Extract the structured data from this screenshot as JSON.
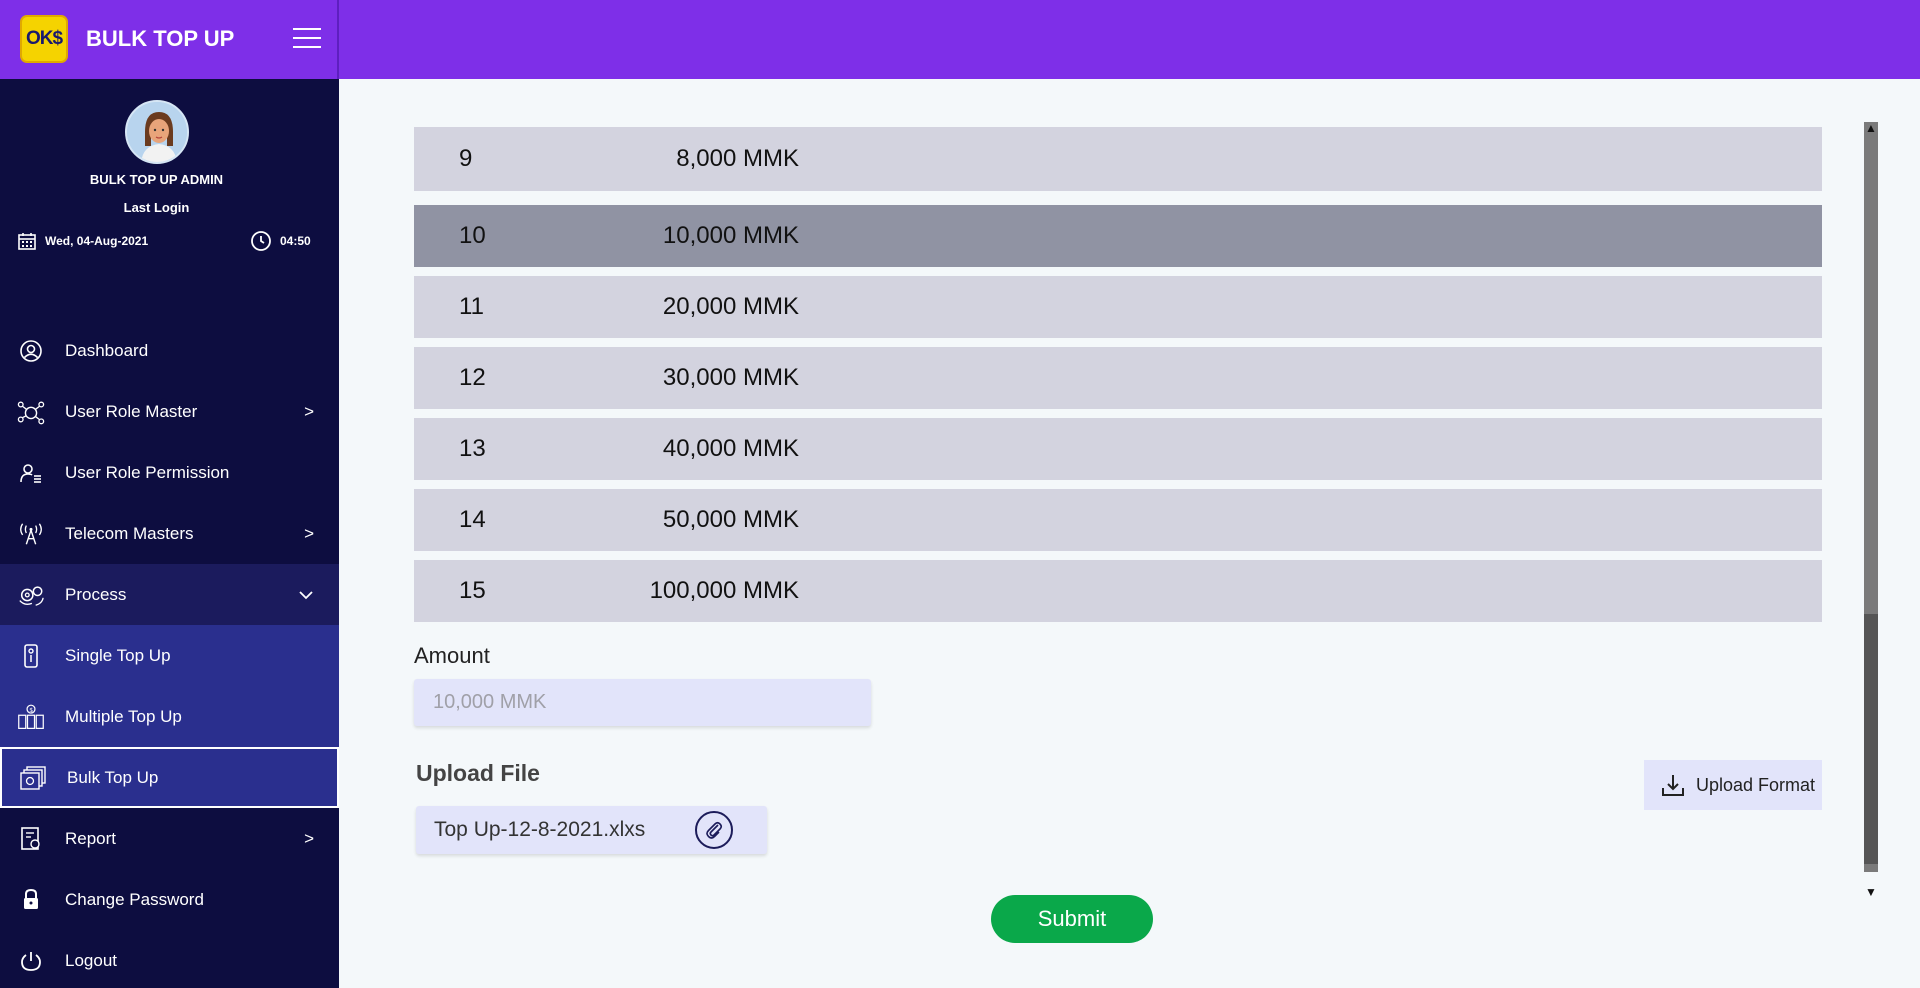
{
  "header": {
    "logo_text": "OK$",
    "brand_title": "BULK TOP UP",
    "accent_color": "#7e2fe8"
  },
  "profile": {
    "name": "BULK TOP UP ADMIN",
    "last_login_label": "Last Login",
    "date": "Wed, 04-Aug-2021",
    "time": "04:50"
  },
  "sidebar": {
    "items": [
      {
        "label": "Dashboard",
        "icon": "user-circle-icon"
      },
      {
        "label": "User Role Master",
        "icon": "network-icon",
        "chevron": ">"
      },
      {
        "label": "User Role Permission",
        "icon": "user-list-icon"
      },
      {
        "label": "Telecom Masters",
        "icon": "antenna-icon",
        "chevron": ">"
      },
      {
        "label": "Process",
        "icon": "gears-icon",
        "chevron": "⌄"
      },
      {
        "label": "Single Top Up",
        "icon": "phone-topup-icon"
      },
      {
        "label": "Multiple Top Up",
        "icon": "multi-topup-icon"
      },
      {
        "label": "Bulk Top Up",
        "icon": "bulk-topup-icon"
      },
      {
        "label": "Report",
        "icon": "report-icon",
        "chevron": ">"
      },
      {
        "label": "Change Password",
        "icon": "lock-icon"
      },
      {
        "label": "Logout",
        "icon": "power-icon"
      }
    ]
  },
  "denominations": [
    {
      "no": "9",
      "amount": "8,000 MMK"
    },
    {
      "no": "10",
      "amount": "10,000 MMK"
    },
    {
      "no": "11",
      "amount": "20,000 MMK"
    },
    {
      "no": "12",
      "amount": "30,000 MMK"
    },
    {
      "no": "13",
      "amount": "40,000 MMK"
    },
    {
      "no": "14",
      "amount": "50,000 MMK"
    },
    {
      "no": "15",
      "amount": "100,000 MMK"
    }
  ],
  "form": {
    "amount_label": "Amount",
    "amount_placeholder": "10,000 MMK",
    "upload_label": "Upload File",
    "file_name": "Top Up-12-8-2021.xlxs",
    "upload_format_label": "Upload Format",
    "submit_label": "Submit"
  },
  "scrollbar": {
    "up_arrow": "▲",
    "down_arrow": "▼"
  }
}
